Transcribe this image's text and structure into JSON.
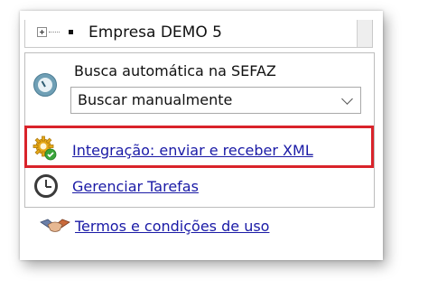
{
  "tree": {
    "company_label": "Empresa DEMO 5",
    "expander_icon": "plus-box-icon"
  },
  "sefaz": {
    "label": "Busca automática na SEFAZ",
    "select_value": "Buscar manualmente",
    "icon": "clock-icon"
  },
  "links": {
    "integration": "Integração: enviar e receber XML",
    "tasks": "Gerenciar Tarefas",
    "terms": "Termos e condições de uso"
  },
  "colors": {
    "highlight_border": "#d9232a",
    "link": "#1a1aa6"
  }
}
